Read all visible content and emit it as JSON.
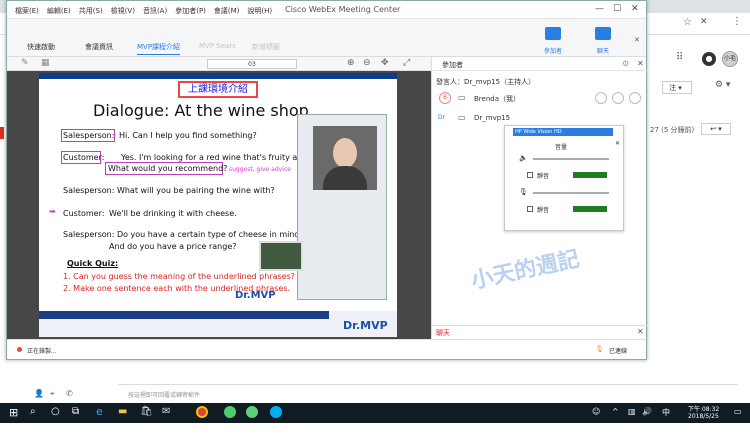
{
  "webex": {
    "menu": [
      "檔案(E)",
      "編輯(E)",
      "共用(S)",
      "檢視(V)",
      "音訊(A)",
      "參加者(P)",
      "會議(M)",
      "說明(H)"
    ],
    "app_title": "Cisco WebEx Meeting Center",
    "tabs": [
      "快速啟動",
      "會議資訊",
      "MVP課程介紹",
      "MVP Sears",
      "新增標籤"
    ],
    "participants_btn": "參加者",
    "chat_btn": "聊天",
    "page_number": "03",
    "status_text": "正在錄製...",
    "connected_text": "已連線"
  },
  "slide": {
    "banner": "上課環境介紹",
    "heading": "Dialogue: At the wine shop",
    "lines": {
      "sp1_label": "Salesperson:",
      "sp1_text": "Hi. Can I help you find something?",
      "c1_label": "Customer:",
      "c1_text": "Yes. I'm looking for a red wine that's fruity and not too dry.",
      "c1_text2": "What would you recommend?",
      "hint": "suggest, give advice",
      "sp2": "Salesperson: What will you be pairing the wine with?",
      "c2_label": "Customer:",
      "c2_text": "We'll be drinking it with cheese.",
      "sp3": "Salesperson:  Do you have a certain type of cheese in mind?",
      "sp3b": "And do you have a price range?",
      "quiz_title": "Quick Quiz:",
      "quiz1": "1.   Can you guess the meaning of the underlined phrases?",
      "quiz2": "2.   Make one sentence each with the underlined phrases."
    },
    "logo": "Dr.MVP"
  },
  "panel": {
    "title": "參加者",
    "host_label": "發言人：Dr_mvp15（主持人）",
    "p1": "Brenda（我）",
    "p2": "Dr_mvp15",
    "dialog_device": "HP Wide Vision HD",
    "dialog_title": "音量",
    "mute1": "靜音",
    "mute2": "靜音",
    "chat": "聊天"
  },
  "watermark": "小天的週記",
  "background": {
    "time_line": "27 (5 分鐘前)",
    "label_note": "注"
  },
  "taskbar": {
    "search_placeholder": "按這裡即可回覆或轉寄郵件",
    "time": "下午 08:32",
    "date": "2018/5/25"
  }
}
